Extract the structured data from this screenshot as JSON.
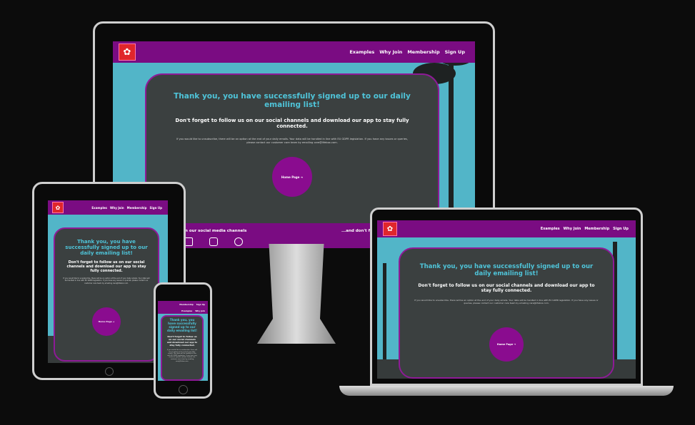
{
  "site": {
    "logo_glyph": "✿",
    "nav_links": [
      "Examples",
      "Why Join",
      "Membership",
      "Sign Up"
    ],
    "heading": "Thank you, you have successfully signed up to our daily emailing list!",
    "subheading": "Don't forget to follow us on our social channels and download our app to stay fully connected.",
    "paragraph": "If you would like to unsubscribe, there will be an option at the end of your daily emails. Your data will be handled in line with EU GDPR legislation. If you have any issues or queries, please contact our customer care team by emailing care@lifebox.com.",
    "home_button": "Home Page ➔",
    "footer_left": "...Follow us on our social media channels",
    "footer_right": "...and don't forget",
    "social_icons": [
      "twitter-icon",
      "instagram-icon",
      "facebook-icon"
    ]
  },
  "colors": {
    "nav": "#7a0c82",
    "card": "#3b4040",
    "accent": "#4fc4d9",
    "sky": "#52b5c8",
    "button": "#8a0c8f"
  }
}
